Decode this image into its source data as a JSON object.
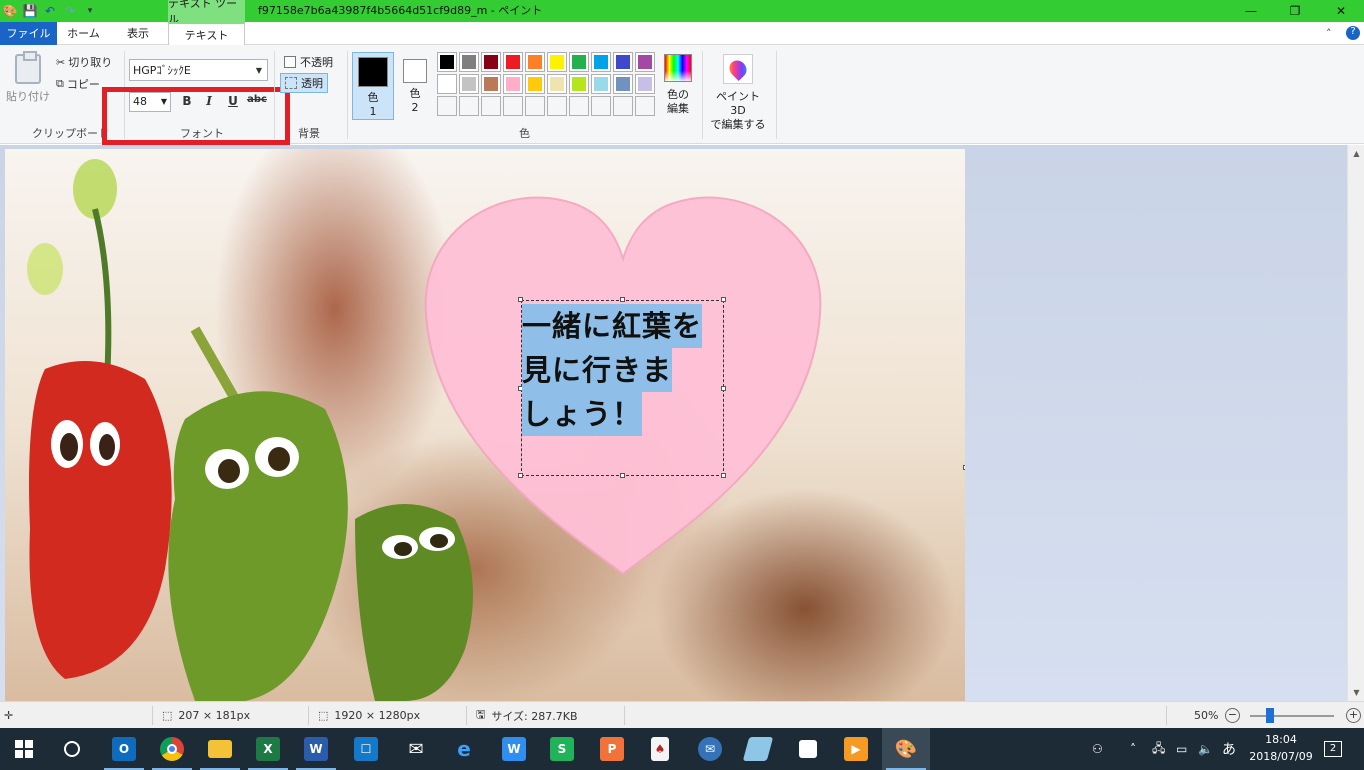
{
  "titlebar": {
    "context_tab_group": "テキスト ツール",
    "document_title": "f97158e7b6a43987f4b5664d51cf9d89_m - ペイント"
  },
  "tabs": {
    "file": "ファイル",
    "home": "ホーム",
    "view": "表示",
    "text": "テキスト"
  },
  "clipboard": {
    "paste": "貼り付け",
    "cut": "切り取り",
    "copy": "コピー",
    "group_label": "クリップボード"
  },
  "font": {
    "family": "HGPｺﾞｼｯｸE",
    "size": "48",
    "bold": "B",
    "italic": "I",
    "underline": "U",
    "strike": "abc",
    "group_label": "フォント"
  },
  "background": {
    "opaque": "不透明",
    "transparent": "透明",
    "group_label": "背景"
  },
  "colors": {
    "color1_label_1": "色",
    "color1_label_2": "1",
    "color1_value": "#000000",
    "color2_label_1": "色",
    "color2_label_2": "2",
    "color2_value": "#ffffff",
    "palette": [
      "#000000",
      "#7f7f7f",
      "#880015",
      "#ed1c24",
      "#ff7f27",
      "#fff200",
      "#22b14c",
      "#00a2e8",
      "#3f48cc",
      "#a349a4",
      "#ffffff",
      "#c3c3c3",
      "#b97a57",
      "#ffaec9",
      "#ffc90e",
      "#efe4b0",
      "#b5e61d",
      "#99d9ea",
      "#7092be",
      "#c8bfe7",
      "#ffffff",
      "#ffffff",
      "#ffffff",
      "#ffffff",
      "#ffffff",
      "#ffffff",
      "#ffffff",
      "#ffffff",
      "#ffffff",
      "#ffffff"
    ],
    "edit_colors_1": "色の",
    "edit_colors_2": "編集",
    "group_label": "色"
  },
  "paint3d": {
    "label_1": "ペイント 3D",
    "label_2": "で編集する"
  },
  "canvas": {
    "heart_color": "#ffc0d6",
    "text_lines": [
      "一緒に紅葉を",
      "見に行きま",
      "しょう！"
    ]
  },
  "statusbar": {
    "selection_size": "207 × 181px",
    "image_size": "1920 × 1280px",
    "file_size": "サイズ: 287.7KB",
    "zoom": "50%"
  },
  "taskbar": {
    "apps": [
      "start-icon",
      "cortana-icon",
      "outlook-icon",
      "chrome-icon",
      "explorer-icon",
      "excel-icon",
      "word-icon",
      "outlook-contacts-icon",
      "mail-icon",
      "edge-icon",
      "wps-writer-icon",
      "wps-spreadsheet-icon",
      "wps-presentation-icon",
      "game-icon",
      "thunderbird-icon",
      "notepad-icon",
      "sticky-note-icon",
      "media-player-icon",
      "paint-icon"
    ],
    "ime": "あ",
    "time": "18:04",
    "date": "2018/07/09",
    "notification_count": "2"
  }
}
